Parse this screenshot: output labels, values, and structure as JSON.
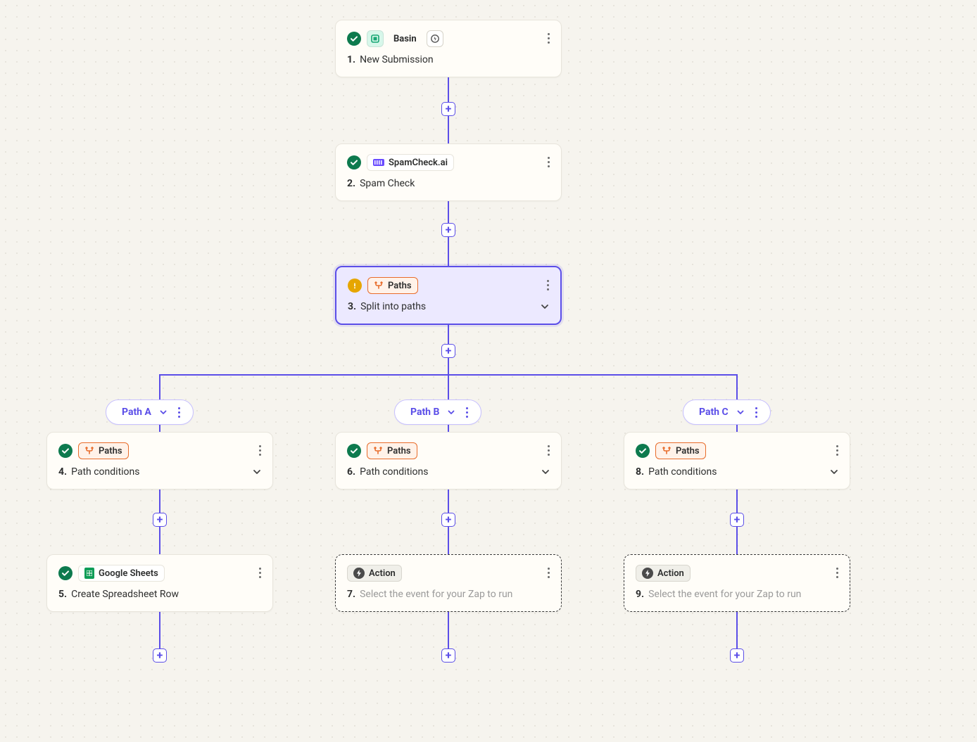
{
  "steps": {
    "s1": {
      "status": "ok",
      "app": "Basin",
      "num": "1.",
      "title": "New Submission"
    },
    "s2": {
      "status": "ok",
      "app": "SpamCheck.ai",
      "num": "2.",
      "title": "Spam Check"
    },
    "s3": {
      "status": "warn",
      "app": "Paths",
      "num": "3.",
      "title": "Split into paths"
    },
    "s4": {
      "status": "ok",
      "app": "Paths",
      "num": "4.",
      "title": "Path conditions"
    },
    "s5": {
      "status": "ok",
      "app": "Google Sheets",
      "num": "5.",
      "title": "Create Spreadsheet Row"
    },
    "s6": {
      "status": "ok",
      "app": "Paths",
      "num": "6.",
      "title": "Path conditions"
    },
    "s7": {
      "app": "Action",
      "num": "7.",
      "title": "Select the event for your Zap to run"
    },
    "s8": {
      "status": "ok",
      "app": "Paths",
      "num": "8.",
      "title": "Path conditions"
    },
    "s9": {
      "app": "Action",
      "num": "9.",
      "title": "Select the event for your Zap to run"
    }
  },
  "paths": {
    "a": "Path A",
    "b": "Path B",
    "c": "Path C"
  },
  "colors": {
    "accent": "#5b4ee8",
    "green": "#0d7a4e",
    "amber": "#e6a600",
    "orange": "#e86c2b"
  }
}
